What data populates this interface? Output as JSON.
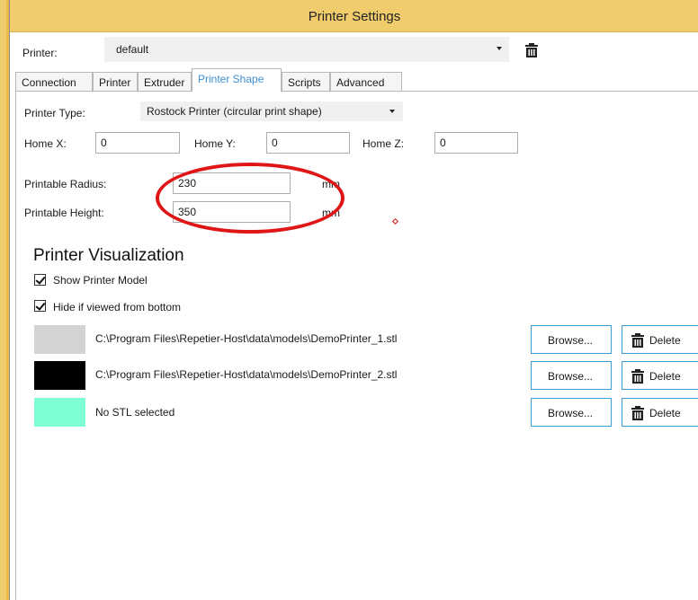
{
  "window": {
    "title": "Printer Settings"
  },
  "printer": {
    "label": "Printer:",
    "value": "default",
    "delete_icon": "trash-icon"
  },
  "tabs": [
    {
      "label": "Connection"
    },
    {
      "label": "Printer"
    },
    {
      "label": "Extruder"
    },
    {
      "label": "Printer Shape",
      "active": true
    },
    {
      "label": "Scripts"
    },
    {
      "label": "Advanced"
    }
  ],
  "shape": {
    "type_label": "Printer Type:",
    "type_value": "Rostock Printer (circular print shape)",
    "home_x_label": "Home X:",
    "home_x": "0",
    "home_y_label": "Home Y:",
    "home_y": "0",
    "home_z_label": "Home Z:",
    "home_z": "0",
    "radius_label": "Printable Radius:",
    "radius": "230",
    "radius_unit": "mm",
    "height_label": "Printable Height:",
    "height": "350",
    "height_unit": "mm"
  },
  "visualization": {
    "title": "Printer Visualization",
    "show_model_label": "Show Printer Model",
    "show_model": true,
    "hide_bottom_label": "Hide if viewed from bottom",
    "hide_bottom": true,
    "browse_label": "Browse...",
    "delete_label": "Delete",
    "models": [
      {
        "color": "#d3d3d3",
        "path": "C:\\Program Files\\Repetier-Host\\data\\models\\DemoPrinter_1.stl"
      },
      {
        "color": "#000000",
        "path": "C:\\Program Files\\Repetier-Host\\data\\models\\DemoPrinter_2.stl"
      },
      {
        "color": "#7fffd4",
        "path": "No STL selected"
      }
    ]
  },
  "colors": {
    "titlebar": "#f0cc6c",
    "accent": "#3c9ad6",
    "annotation": "#e01616"
  }
}
